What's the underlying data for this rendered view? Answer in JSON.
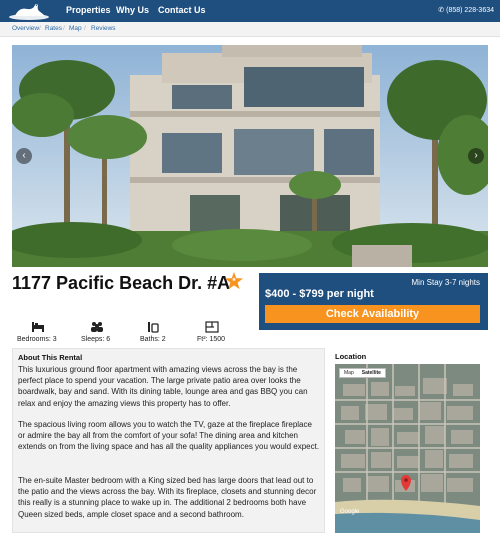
{
  "header": {
    "brand_icon": "seal-logo",
    "nav": [
      "Properties",
      "Why Us",
      "Contact Us"
    ],
    "phone": "(858) 228-3634",
    "phone_icon": "phone-icon"
  },
  "subnav": {
    "links": [
      "Overview",
      "Rates",
      "Map",
      "Reviews"
    ]
  },
  "hero": {
    "prev_icon": "chevron-left-icon",
    "next_icon": "chevron-right-icon"
  },
  "listing": {
    "title": "1177 Pacific Beach Dr. #A",
    "badge": "★"
  },
  "pricing": {
    "min_stay": "Min Stay 3-7 nights",
    "price": "$400 - $799 per night",
    "cta": "Check Availability"
  },
  "amenities": [
    {
      "icon": "bed-icon",
      "label": "Bedrooms: 3"
    },
    {
      "icon": "people-icon",
      "label": "Sleeps: 6"
    },
    {
      "icon": "bath-icon",
      "label": "Baths: 2"
    },
    {
      "icon": "floorplan-icon",
      "label": "Ft²: 1500"
    }
  ],
  "about": {
    "title": "About This Rental",
    "paragraphs": [
      "This luxurious ground floor apartment with amazing views across the bay is the perfect place to spend your vacation. The large private patio area over looks the boardwalk, bay and sand. With its dining table, lounge area and gas BBQ you can relax and enjoy the amazing views this property has to offer.",
      "The spacious living room allows you to watch the TV, gaze at the fireplace fireplace or admire the bay all from the comfort of your sofa! The dining area and kitchen extends on from the living space and has all the quality appliances you would expect.",
      "The en-suite Master bedroom with a King sized bed has large doors that lead out to the patio and the views across the bay. With its fireplace, closets and stunning decor this really is a stunning place to wake up in. The additional 2 bedrooms both have Queen sized beds, ample closet space and a second bathroom."
    ]
  },
  "location": {
    "title": "Location",
    "map_toggle": [
      "Map",
      "Satellite"
    ],
    "map_brand": "Google"
  },
  "colors": {
    "navy": "#1f4f7f",
    "orange": "#f7931e",
    "link": "#2a6aa8"
  }
}
